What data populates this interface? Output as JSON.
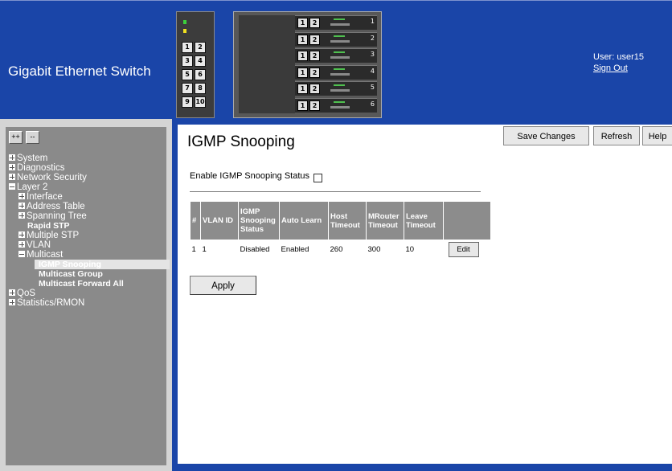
{
  "header": {
    "brand": "Gigabit Ethernet Switch",
    "user_label": "User: user15",
    "sign_out": "Sign Out",
    "front_ports": [
      [
        "1",
        "2"
      ],
      [
        "3",
        "4"
      ],
      [
        "5",
        "6"
      ],
      [
        "7",
        "8"
      ],
      [
        "9",
        "10"
      ]
    ],
    "blades": [
      "1",
      "2",
      "3",
      "4",
      "5",
      "6"
    ]
  },
  "sidebar": {
    "expand_all": "++",
    "collapse_all": "--",
    "tree": [
      {
        "label": "System",
        "state": "collapsed",
        "level": 0
      },
      {
        "label": "Diagnostics",
        "state": "collapsed",
        "level": 0
      },
      {
        "label": "Network Security",
        "state": "collapsed",
        "level": 0
      },
      {
        "label": "Layer 2",
        "state": "expanded",
        "level": 0
      },
      {
        "label": "Interface",
        "state": "collapsed",
        "level": 1
      },
      {
        "label": "Address Table",
        "state": "collapsed",
        "level": 1
      },
      {
        "label": "Spanning Tree",
        "state": "collapsed",
        "level": 1
      },
      {
        "label": "Rapid STP",
        "state": "leaf",
        "level": 1
      },
      {
        "label": "Multiple STP",
        "state": "collapsed",
        "level": 1
      },
      {
        "label": "VLAN",
        "state": "collapsed",
        "level": 1
      },
      {
        "label": "Multicast",
        "state": "expanded",
        "level": 1
      },
      {
        "label": "IGMP Snooping",
        "state": "leaf",
        "level": 2,
        "selected": true
      },
      {
        "label": "Multicast Group",
        "state": "leaf",
        "level": 2
      },
      {
        "label": "Multicast Forward All",
        "state": "leaf",
        "level": 2
      },
      {
        "label": "QoS",
        "state": "collapsed",
        "level": 0
      },
      {
        "label": "Statistics/RMON",
        "state": "collapsed",
        "level": 0
      }
    ]
  },
  "main": {
    "title": "IGMP Snooping",
    "buttons": {
      "save": "Save Changes",
      "refresh": "Refresh",
      "help": "Help"
    },
    "enable_label": "Enable IGMP Snooping Status",
    "enable_checked": false,
    "table": {
      "headers": [
        "#",
        "VLAN ID",
        "IGMP Snooping Status",
        "Auto Learn",
        "Host Timeout",
        "MRouter Timeout",
        "Leave Timeout",
        ""
      ],
      "rows": [
        [
          "1",
          "1",
          "Disabled",
          "Enabled",
          "260",
          "300",
          "10"
        ]
      ],
      "edit_label": "Edit"
    },
    "apply_label": "Apply"
  },
  "colors": {
    "header_blue": "#1a45a8",
    "sidebar_gray": "#8a8a8a",
    "table_header": "#8c8c8c"
  }
}
